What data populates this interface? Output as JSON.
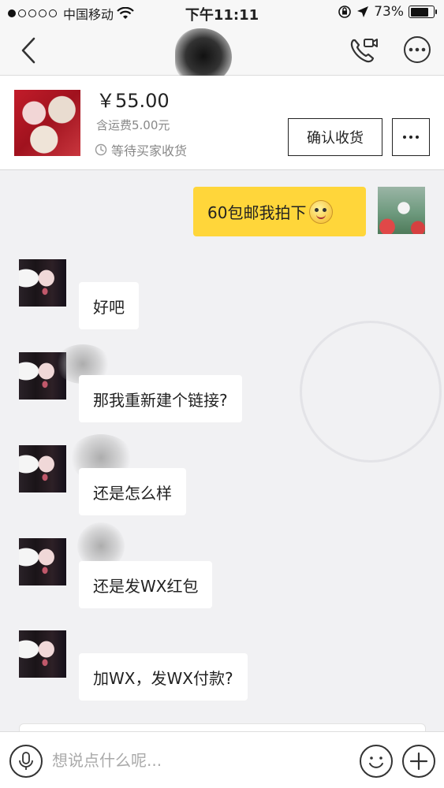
{
  "status_bar": {
    "carrier": "中国移动",
    "time": "下午11:11",
    "battery_percent": "73%",
    "battery_level": 0.73,
    "signal_bars_filled": 1,
    "signal_bars_total": 5
  },
  "nav": {
    "back_icon": "chevron-left-icon",
    "call_icon": "phone-video-icon",
    "more_icon": "more-circle-icon"
  },
  "product": {
    "price": "￥55.00",
    "shipping": "含运费5.00元",
    "status": "等待买家收货",
    "confirm_button": "确认收货",
    "more_button_icon": "ellipsis-icon"
  },
  "messages": [
    {
      "sender": "me",
      "text": "60包邮我拍下",
      "has_emoji": true
    },
    {
      "sender": "them",
      "text": "好吧"
    },
    {
      "sender": "them",
      "text": "那我重新建个链接?"
    },
    {
      "sender": "them",
      "text": "还是怎么样"
    },
    {
      "sender": "them",
      "text": "还是发WX红包"
    },
    {
      "sender": "them",
      "text": "加WX，发WX付款?"
    }
  ],
  "input_bar": {
    "placeholder": "想说点什么呢...",
    "mic_icon": "microphone-icon",
    "emoji_icon": "smiley-icon",
    "plus_icon": "plus-icon"
  },
  "colors": {
    "my_bubble": "#ffd63a",
    "their_bubble": "#ffffff",
    "chat_background": "#f1f1f3"
  }
}
